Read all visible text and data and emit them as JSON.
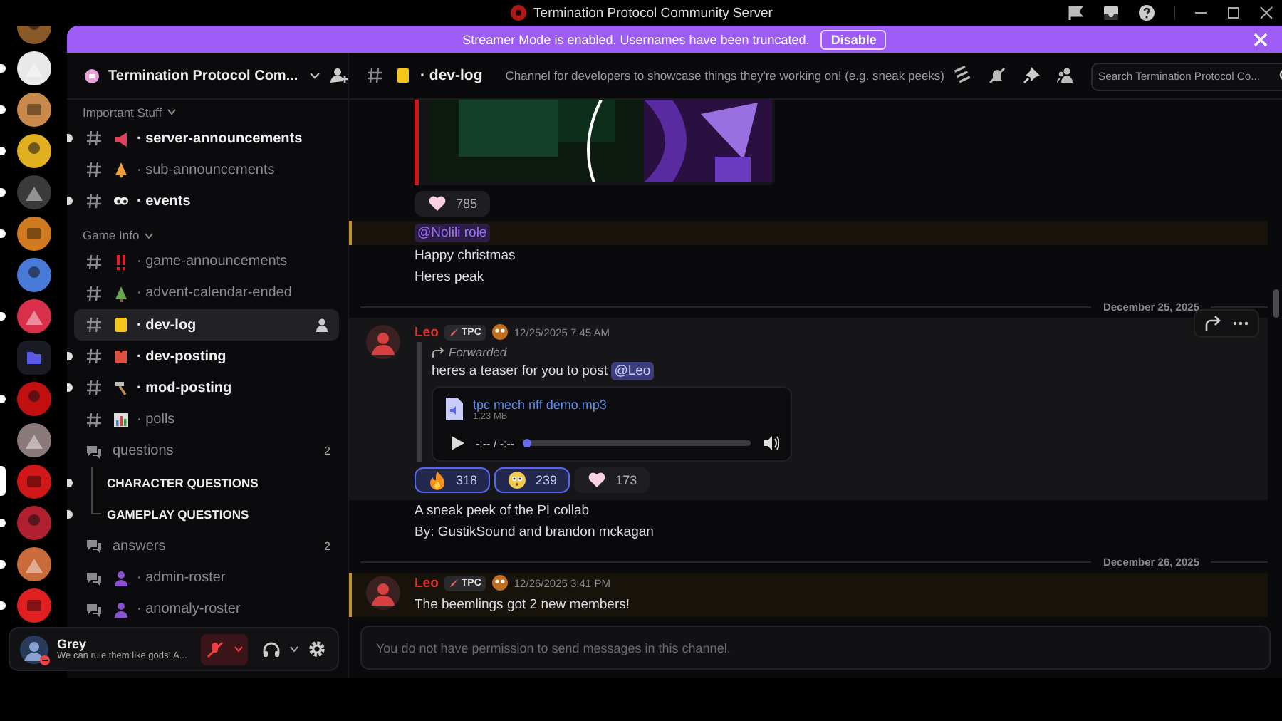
{
  "titlebar": {
    "title": "Termination Protocol Community Server"
  },
  "banner": {
    "text": "Streamer Mode is enabled. Usernames have been truncated.",
    "button": "Disable"
  },
  "servers": [
    {
      "color": "#8a5a2b",
      "unread": false,
      "selected": false
    },
    {
      "color": "#e8e8e8",
      "unread": true,
      "selected": false
    },
    {
      "color": "#c9894a",
      "unread": true,
      "selected": false
    },
    {
      "color": "#e0b020",
      "unread": true,
      "selected": false
    },
    {
      "color": "#3a3a3a",
      "unread": true,
      "selected": false
    },
    {
      "color": "#d07a20",
      "unread": true,
      "selected": false
    },
    {
      "color": "#4a7ad8",
      "unread": false,
      "selected": false
    },
    {
      "color": "#d8304a",
      "unread": true,
      "selected": false
    },
    {
      "unread": false,
      "selected": false,
      "kind": "folder"
    },
    {
      "color": "#c01010",
      "unread": true,
      "selected": false
    },
    {
      "color": "#8a7a7a",
      "unread": false,
      "selected": false
    },
    {
      "color": "#d01818",
      "unread": false,
      "selected": true
    },
    {
      "color": "#b02030",
      "unread": true,
      "selected": false
    },
    {
      "color": "#c86a3a",
      "unread": true,
      "selected": false
    },
    {
      "color": "#e02020",
      "unread": true,
      "selected": false
    }
  ],
  "sidebar": {
    "server_name": "Termination Protocol Com...",
    "categories": [
      {
        "name": "Important Stuff",
        "expanded": true,
        "channels": [
          {
            "name": "· server-announcements",
            "kind": "text",
            "unread": true,
            "selected": false
          },
          {
            "name": "· sub-announcements",
            "kind": "text",
            "unread": false,
            "selected": false
          },
          {
            "name": "· events",
            "kind": "text",
            "unread": true,
            "selected": false
          }
        ]
      },
      {
        "name": "Game Info",
        "expanded": true,
        "channels": [
          {
            "name": "· game-announcements",
            "kind": "text",
            "unread": false,
            "selected": false
          },
          {
            "name": "· advent-calendar-ended",
            "kind": "text",
            "unread": false,
            "selected": false
          },
          {
            "name": "· dev-log",
            "kind": "text",
            "unread": false,
            "selected": true
          },
          {
            "name": "· dev-posting",
            "kind": "text",
            "unread": true,
            "selected": false
          },
          {
            "name": "· mod-posting",
            "kind": "text",
            "unread": true,
            "selected": false
          },
          {
            "name": "· polls",
            "kind": "text",
            "unread": false,
            "selected": false
          },
          {
            "name": "questions",
            "kind": "forum",
            "unread": false,
            "selected": false,
            "count": "2",
            "children": [
              {
                "name": "CHARACTER QUESTIONS",
                "unread": true
              },
              {
                "name": "GAMEPLAY QUESTIONS",
                "unread": true
              }
            ]
          },
          {
            "name": "answers",
            "kind": "forum",
            "unread": false,
            "selected": false,
            "count": "2"
          },
          {
            "name": "· admin-roster",
            "kind": "forum",
            "unread": false,
            "selected": false
          },
          {
            "name": "· anomaly-roster",
            "kind": "forum",
            "unread": false,
            "selected": false
          }
        ]
      }
    ]
  },
  "user": {
    "name": "Grey",
    "status_text": "We can rule them like gods! A...",
    "do_not_disturb": true,
    "mic_muted": true
  },
  "header": {
    "channel": "· dev-log",
    "topic": "Channel for developers to showcase things they're working on! (e.g. sneak peeks)",
    "search_placeholder": "Search Termination Protocol Co..."
  },
  "messages": [
    {
      "kind": "tail",
      "highlighted": false,
      "attachment": {
        "kind": "picture"
      },
      "reactions": [
        {
          "count": "785",
          "selected": false
        }
      ]
    },
    {
      "kind": "tail",
      "highlighted": true,
      "lines": [
        {
          "mention": "@Nolili role",
          "kind": "role"
        }
      ]
    },
    {
      "kind": "tail",
      "highlighted": false,
      "lines": [
        {
          "text": "Happy christmas"
        },
        {
          "text": "Heres peak"
        }
      ]
    },
    {
      "kind": "divider",
      "date": "December 25, 2025"
    },
    {
      "kind": "message",
      "highlighted": false,
      "hovered": true,
      "author": "Leo",
      "badge": "TPC",
      "timestamp": "12/25/2025 7:45 AM",
      "forwarded": {
        "label": "Forwarded",
        "lines": [
          {
            "text": "heres a teaser for you to post ",
            "mention": "@Leo",
            "kind": "user"
          }
        ],
        "audio": {
          "filename": "tpc mech riff demo.mp3",
          "size": "1.23 MB",
          "time": "-:-- / -:--"
        }
      },
      "reactions": [
        {
          "count": "318",
          "selected": true
        },
        {
          "count": "239",
          "selected": true
        },
        {
          "count": "173",
          "selected": false
        }
      ]
    },
    {
      "kind": "tail",
      "highlighted": false,
      "lines": [
        {
          "text": "A sneak peek of the PI collab"
        },
        {
          "text": "By: GustikSound and brandon mckagan"
        }
      ]
    },
    {
      "kind": "divider",
      "date": "December 26, 2025"
    },
    {
      "kind": "message",
      "highlighted": true,
      "hovered": false,
      "author": "Leo",
      "badge": "TPC",
      "timestamp": "12/26/2025 3:41 PM",
      "lines": [
        {
          "text": "The beemlings got 2 new members!"
        }
      ]
    }
  ],
  "composer": {
    "placeholder": "You do not have permission to send messages in this channel.",
    "disabled": true
  }
}
